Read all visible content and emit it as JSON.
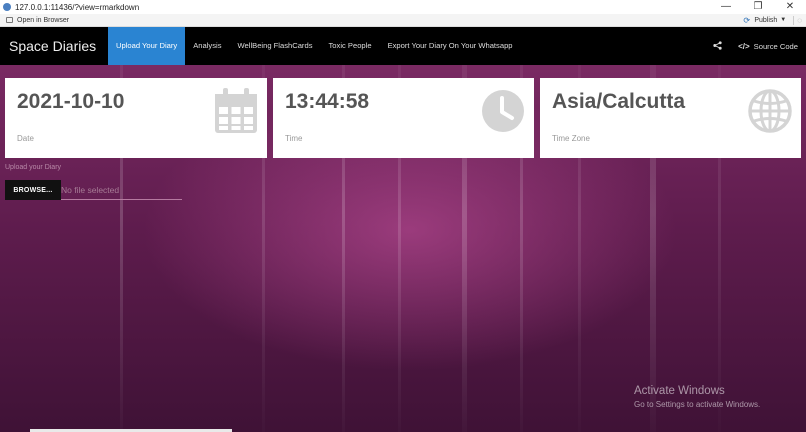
{
  "window": {
    "url": "127.0.0.1:11436/?view=rmarkdown",
    "minimize": "—",
    "restore": "❐",
    "close": "✕"
  },
  "toolbar": {
    "open_in_browser": "Open in Browser",
    "publish": "Publish"
  },
  "navbar": {
    "brand": "Space Diaries",
    "tabs": [
      {
        "label": "Upload Your Diary",
        "active": true
      },
      {
        "label": "Analysis"
      },
      {
        "label": "WellBeing FlashCards"
      },
      {
        "label": "Toxic People"
      },
      {
        "label": "Export Your Diary On Your Whatsapp"
      }
    ],
    "source_code": "Source Code"
  },
  "cards": [
    {
      "value": "2021-10-10",
      "label": "Date",
      "icon": "calendar-icon"
    },
    {
      "value": "13:44:58",
      "label": "Time",
      "icon": "clock-icon"
    },
    {
      "value": "Asia/Calcutta",
      "label": "Time Zone",
      "icon": "globe-icon"
    }
  ],
  "upload": {
    "label": "Upload your Diary",
    "button": "BROWSE...",
    "placeholder": "No file selected"
  },
  "watermark": {
    "line1": "Activate Windows",
    "line2": "Go to Settings to activate Windows."
  },
  "colors": {
    "accent": "#2a84d2",
    "navbar": "#000000",
    "background": "#6b2358"
  }
}
